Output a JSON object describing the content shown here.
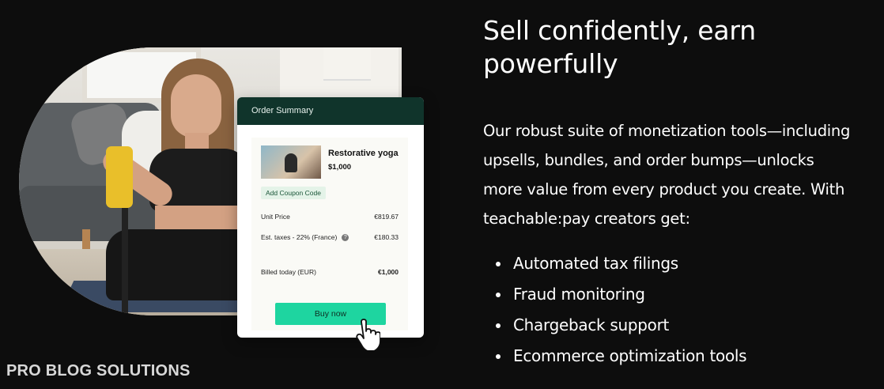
{
  "order_summary": {
    "title": "Order Summary",
    "product_name": "Restorative yoga",
    "product_price": "$1,000",
    "coupon_label": "Add Coupon Code",
    "unit_price_label": "Unit Price",
    "unit_price_value": "€819.67",
    "tax_label": "Est. taxes - 22% (France)",
    "tax_value": "€180.33",
    "billed_label": "Billed today (EUR)",
    "billed_value": "€1,000",
    "buy_button": "Buy now",
    "help_icon": "question-circle-icon",
    "cursor_icon": "hand-pointer-icon"
  },
  "content": {
    "headline": "Sell confidently, earn powerfully",
    "body": "Our robust suite of monetization tools—including upsells, bundles, and order bumps—unlocks more value from every product you create. With teachable:pay creators get:",
    "features": [
      "Automated tax filings",
      "Fraud monitoring",
      "Chargeback support",
      "Ecommerce optimization tools"
    ]
  },
  "watermark": "PRO BLOG SOLUTIONS",
  "colors": {
    "background": "#0d0d0d",
    "card_header": "#10342b",
    "buy_button": "#1ed5a0",
    "coupon_bg": "#e4f3e8",
    "text": "#ffffff"
  }
}
